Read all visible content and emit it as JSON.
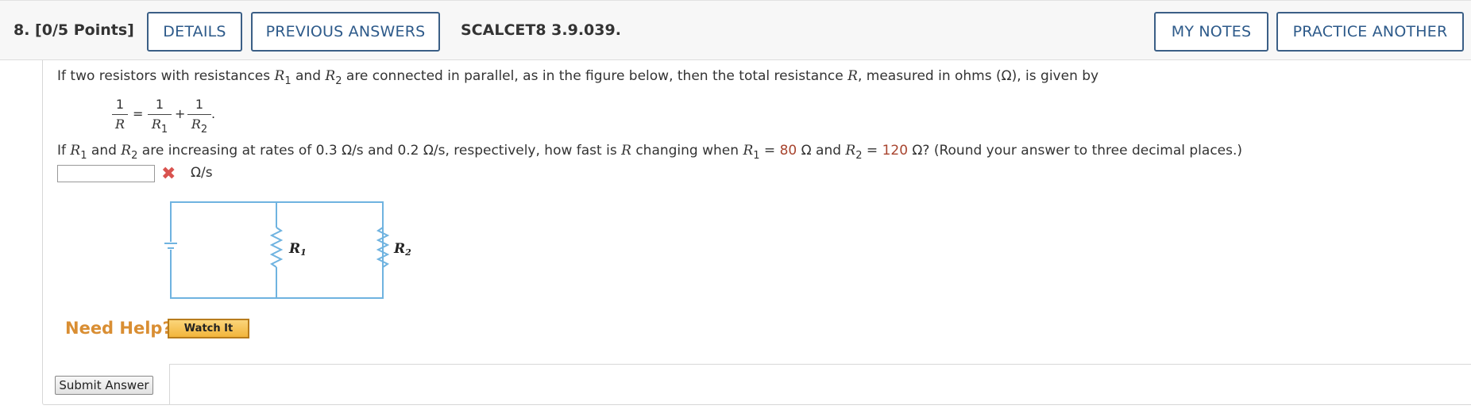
{
  "header": {
    "question_label": "8.  [0/5 Points]",
    "details_label": "DETAILS",
    "previous_answers_label": "PREVIOUS ANSWERS",
    "problem_code": "SCALCET8 3.9.039.",
    "my_notes_label": "MY NOTES",
    "practice_another_label": "PRACTICE ANOTHER"
  },
  "problem": {
    "intro_part1": "If two resistors with resistances ",
    "r": "R",
    "sub1": "1",
    "sub2": "2",
    "and": " and ",
    "intro_part2": " are connected in parallel, as in the figure below, then the total resistance ",
    "intro_part3": ", measured in ohms (Ω), is given by",
    "formula": {
      "one": "1",
      "eq": "=",
      "plus": "+",
      "period": "."
    },
    "question_part1": "If ",
    "question_part2": " are increasing at rates of 0.3 Ω/s and 0.2 Ω/s, respectively, how fast is ",
    "question_part3": " changing when ",
    "eq": " = ",
    "r1_value": "80",
    "r2_value": "120",
    "ohm": " Ω",
    "question_and": " Ω and ",
    "question_part4": " Ω? (Round your answer to three decimal places.)",
    "answer_value": "",
    "answer_unit": "Ω/s",
    "status_icon": "x-mark-icon"
  },
  "figure": {
    "label_r1": "R",
    "label_r1_sub": "1",
    "label_r2": "R",
    "label_r2_sub": "2",
    "wire_color": "#6fb3e0"
  },
  "help": {
    "need_help_label": "Need Help?",
    "watch_it_label": "Watch It"
  },
  "footer": {
    "submit_label": "Submit Answer"
  },
  "colors": {
    "accent": "#2d5a8a",
    "wrong": "#d9534f",
    "value_highlight": "#a8452f",
    "help": "#d98e33"
  }
}
